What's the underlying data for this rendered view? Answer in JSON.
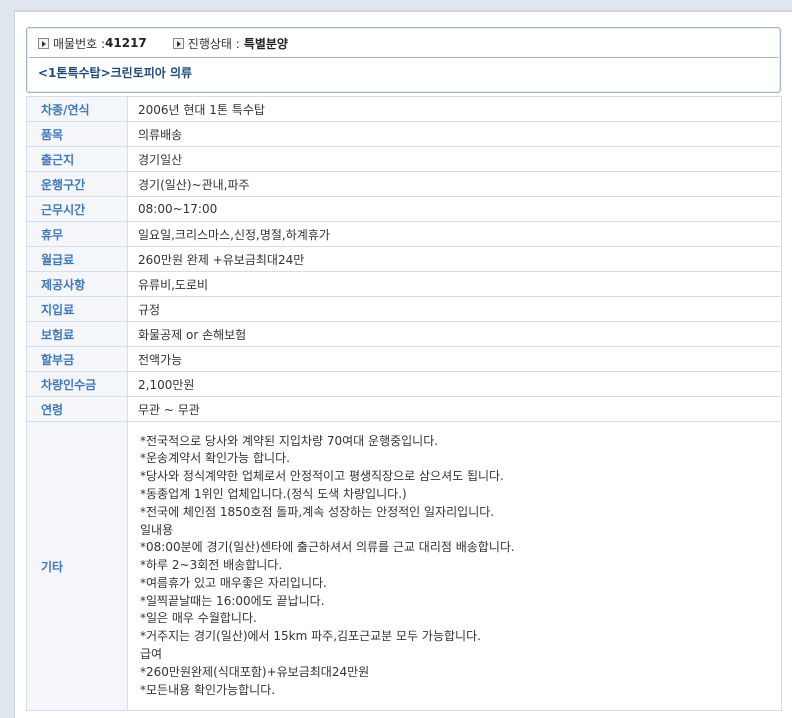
{
  "header": {
    "listing_no_label": "매물번호 :",
    "listing_no_value": "41217",
    "status_label": "진행상태 :",
    "status_value": "특별분양",
    "title": "<1톤특수탑>크린토피아 의류"
  },
  "rows": [
    {
      "label": "차종/연식",
      "value": "2006년 현대 1톤 특수탑"
    },
    {
      "label": "품목",
      "value": "의류배송"
    },
    {
      "label": "출근지",
      "value": "경기일산"
    },
    {
      "label": "운행구간",
      "value": "경기(일산)~관내,파주"
    },
    {
      "label": "근무시간",
      "value": "08:00~17:00"
    },
    {
      "label": "휴무",
      "value": "일요일,크리스마스,신정,명절,하계휴가"
    },
    {
      "label": "월급료",
      "value": "260만원 완제 +유보금최대24만"
    },
    {
      "label": "제공사항",
      "value": "유류비,도로비"
    },
    {
      "label": "지입료",
      "value": "규정"
    },
    {
      "label": "보험료",
      "value": "화물공제 or 손해보험"
    },
    {
      "label": "할부금",
      "value": "전액가능"
    },
    {
      "label": "차량인수금",
      "value": "2,100만원"
    },
    {
      "label": "연령",
      "value": "무관 ~ 무관"
    }
  ],
  "etc": {
    "label": "기타",
    "lines": [
      "*전국적으로 당사와 계약된 지입차량 70여대 운행중입니다.",
      "*운송계약서 확인가능 합니다.",
      "*당사와 정식계약한 업체로서 안정적이고 평생직장으로 삼으셔도 됩니다.",
      "*동종업계 1위인 업체입니다.(정식 도색 차량입니다.)",
      "*전국에 체인점 1850호점 돌파,계속 성장하는 안정적인 일자리입니다.",
      "일내용",
      "*08:00분에 경기(일산)센타에 출근하셔서 의류를 근교 대리점 배송합니다.",
      "*하루 2~3회전 배송합니다.",
      "*여름휴가 있고 매우좋은 자리입니다.",
      "*일찍끝날때는 16:00에도 끝납니다.",
      "*일은 매우 수월합니다.",
      "*거주지는 경기(일산)에서 15km 파주,김포근교분 모두 가능합니다.",
      "급여",
      "*260만원완제(식대포함)+유보금최대24만원",
      "*모든내용 확인가능합니다."
    ]
  }
}
